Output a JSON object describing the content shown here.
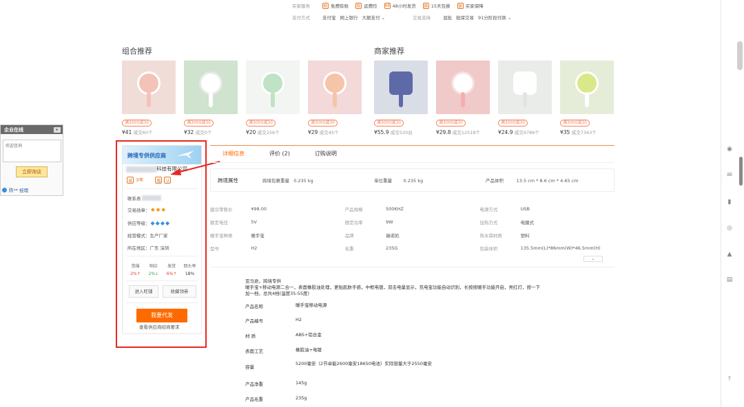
{
  "services": {
    "row1_label": "买家服务",
    "row1_items": [
      {
        "icon": "free-shipping-icon",
        "label": "免费赊账"
      },
      {
        "icon": "shipping-insurance-icon",
        "label": "运费险"
      },
      {
        "icon": "48h-ship-icon",
        "label": "48小时发货"
      },
      {
        "icon": "15day-exchange-icon",
        "label": "15天包换"
      },
      {
        "icon": "buyer-protection-icon",
        "label": "买家保障"
      }
    ],
    "row2_label": "支付方式",
    "row2_items": [
      "支付宝",
      "网上银行",
      "大额支付"
    ],
    "row2_label_b": "交易支持",
    "row2_items_b": [
      "混批",
      "担保交易",
      "91分阶段付款"
    ]
  },
  "combo": {
    "title": "组合推荐",
    "products": [
      {
        "tag": "满3000减30",
        "price": "¥41",
        "sold": "成交60个"
      },
      {
        "tag": "满3000减30",
        "price": "¥32",
        "sold": "成交0个"
      },
      {
        "tag": "满3000减30",
        "price": "¥20",
        "sold": "成交256个"
      },
      {
        "tag": "满3000减30",
        "price": "¥29",
        "sold": "成交45个"
      }
    ]
  },
  "merchant": {
    "title": "商家推荐",
    "products": [
      {
        "tag": "满3000减30",
        "price": "¥55.9",
        "sold": "成交520台"
      },
      {
        "tag": "满3000减30",
        "price": "¥29.8",
        "sold": "成交12518个"
      },
      {
        "tag": "满3000减30",
        "price": "¥24.9",
        "sold": "成交9786个"
      },
      {
        "tag": "满3000减30",
        "price": "¥35",
        "sold": "成交7343个"
      }
    ]
  },
  "enterprise": {
    "title": "企业在线",
    "placeholder": "欢迎咨询",
    "button": "立即询谈",
    "manager": "陈** 经理"
  },
  "supplier": {
    "banner": "跨境专供供应商",
    "company_suffix": "科技有限公司",
    "years": "3年",
    "contact_label": "联系表",
    "trade_label": "交易勋章：",
    "level_label": "供应等级：",
    "mode_label": "经营模式：",
    "mode_value": "生产厂家",
    "area_label": "所在地区：",
    "area_value": "广东 深圳",
    "stats": [
      {
        "k": "货描",
        "v": "2%↑",
        "trend": "up"
      },
      {
        "k": "响应",
        "v": "2%↓",
        "trend": "down"
      },
      {
        "k": "发货",
        "v": "6%↑",
        "trend": "up"
      },
      {
        "k": "回头率",
        "v": "18%",
        "trend": "none"
      }
    ],
    "shop_button": "进入旺铺",
    "follow_button": "收藏领券",
    "agent_button": "我要代发",
    "agent_note": "查看供应商招商要求"
  },
  "tabs": [
    "详细信息",
    "评价 (2)",
    "订购说明"
  ],
  "attr_head": {
    "category": "跨境属性",
    "items": [
      {
        "k": "跨境包裹重量",
        "v": "0.235 kg"
      },
      {
        "k": "单位重量",
        "v": "0.235 kg"
      },
      {
        "k": "产品体积",
        "v": "13.5 cm * 8.6 cm * 4.65 cm"
      }
    ]
  },
  "attrs": [
    [
      {
        "k": "建议零售价",
        "v": "¥98.00"
      },
      {
        "k": "产品规格",
        "v": "500KHZ"
      },
      {
        "k": "电源方式",
        "v": "USB"
      }
    ],
    [
      {
        "k": "额定电压",
        "v": "5V"
      },
      {
        "k": "额定功率",
        "v": "9W"
      },
      {
        "k": "加热方式",
        "v": "电膜式"
      }
    ],
    [
      {
        "k": "暖手宝种类",
        "v": "暖手宝"
      },
      {
        "k": "品牌",
        "v": "瑞诺凯"
      },
      {
        "k": "热水袋材质",
        "v": "塑料"
      }
    ],
    [
      {
        "k": "型号",
        "v": "H2"
      },
      {
        "k": "毛重",
        "v": "235G"
      },
      {
        "k": "包装体积",
        "v": "135.5mm(L)*86mm(W)*46.5mm(H)"
      }
    ]
  ],
  "description": [
    "亚马逊，跨境专供",
    "暖手宝+移动电源二合一，表面橡胶油处理，更贴肌肤手感，中框电镀，双击电量显示，充电宝功能自动识别，长按按暖手功能开启，亮红灯，按一下",
    "加一档，总共4档(温度35-55度)"
  ],
  "specs": [
    {
      "k": "产品名称",
      "v": "暖手宝移动电源"
    },
    {
      "k": "产品编号",
      "v": "H2"
    },
    {
      "k": "材 质",
      "v": "ABS+铝合金"
    },
    {
      "k": "表面工艺",
      "v": "橡胶油+电镀"
    },
    {
      "k": "容量",
      "v": "5200毫安（2节卓能2600毫安18650电池）实际容量大于2550毫安"
    },
    {
      "k": "产品净重",
      "v": "145g"
    },
    {
      "k": "产品毛重",
      "v": "235g"
    }
  ],
  "colors": {
    "accent": "#ff6a00",
    "highlight": "#e8271e",
    "link": "#2167b6"
  }
}
